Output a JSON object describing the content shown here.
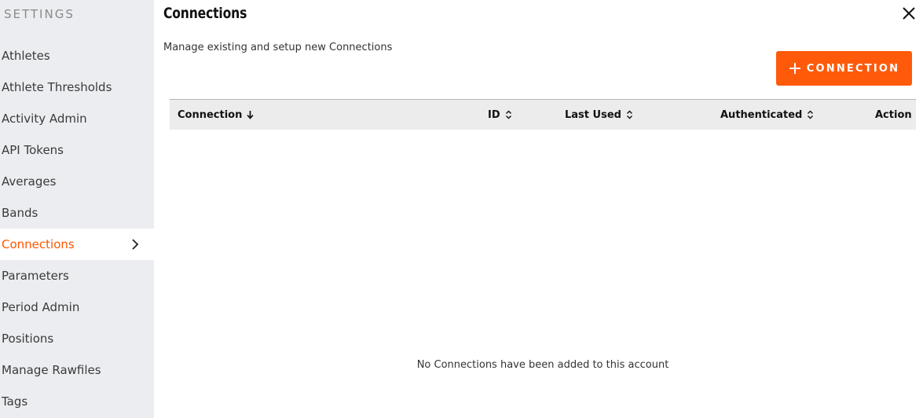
{
  "sidebar": {
    "header": "SETTINGS",
    "items": [
      {
        "label": "Athletes"
      },
      {
        "label": "Athlete Thresholds"
      },
      {
        "label": "Activity Admin"
      },
      {
        "label": "API Tokens"
      },
      {
        "label": "Averages"
      },
      {
        "label": "Bands"
      },
      {
        "label": "Connections",
        "active": true
      },
      {
        "label": "Parameters"
      },
      {
        "label": "Period Admin"
      },
      {
        "label": "Positions"
      },
      {
        "label": "Manage Rawfiles"
      },
      {
        "label": "Tags"
      }
    ]
  },
  "page": {
    "title": "Connections",
    "subtitle": "Manage existing and setup new Connections",
    "add_button_label": "CONNECTION"
  },
  "table": {
    "columns": [
      {
        "label": "Connection",
        "sort": "descending"
      },
      {
        "label": "ID",
        "sort": "sortable"
      },
      {
        "label": "Last Used",
        "sort": "sortable"
      },
      {
        "label": "Authenticated",
        "sort": "sortable"
      },
      {
        "label": "Action",
        "sort": "none"
      }
    ],
    "rows": [],
    "empty_message": "No Connections have been added to this account"
  },
  "colors": {
    "accent": "#ff5a0a",
    "sidebar_bg": "#ecedf0",
    "header_bg": "#ececec"
  },
  "icons": {
    "close": "close-icon",
    "add": "plus-icon",
    "active_nav": "chevron-right-icon",
    "sort_desc": "arrow-down-icon",
    "sortable": "sort-icon"
  }
}
